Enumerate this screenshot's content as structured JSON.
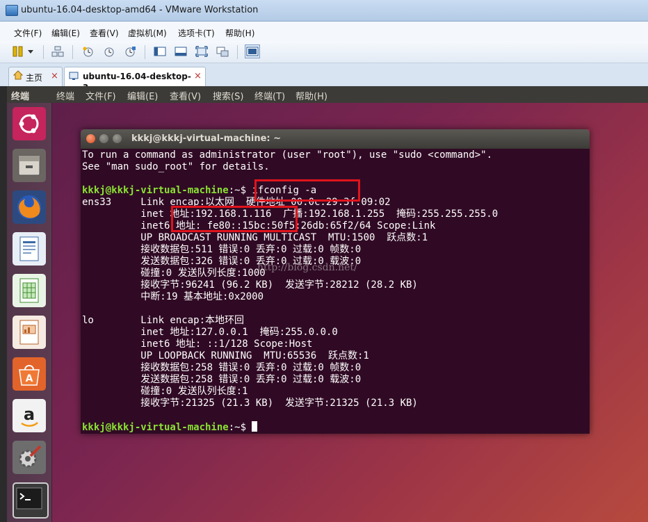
{
  "window": {
    "title": "ubuntu-16.04-desktop-amd64 - VMware Workstation"
  },
  "menu": [
    "文件(F)",
    "编辑(E)",
    "查看(V)",
    "虚拟机(M)",
    "选项卡(T)",
    "帮助(H)"
  ],
  "tabs": [
    {
      "label": "主页",
      "close": "×"
    },
    {
      "label": "ubuntu-16.04-desktop-a...",
      "close": "×"
    }
  ],
  "ubuntu_panel": {
    "app_name": "终端",
    "menu": [
      "终端",
      "文件(F)",
      "编辑(E)",
      "查看(V)",
      "搜索(S)",
      "终端(T)",
      "帮助(H)"
    ]
  },
  "launcher": [
    "ubuntu-dash-icon",
    "files-icon",
    "firefox-icon",
    "writer-icon",
    "calc-icon",
    "impress-icon",
    "software-center-icon",
    "amazon-icon",
    "settings-icon",
    "terminal-icon"
  ],
  "terminal": {
    "title": "kkkj@kkkj-virtual-machine: ~",
    "lines": [
      "To run a command as administrator (user \"root\"), use \"sudo <command>\".",
      "See \"man sudo_root\" for details.",
      "",
      "",
      "ens33     Link encap:以太网  硬件地址 00:0c:29:3f:09:02",
      "          inet 地址:192.168.1.116  广播:192.168.1.255  掩码:255.255.255.0",
      "          inet6 地址: fe80::15bc:50f5:26db:65f2/64 Scope:Link",
      "          UP BROADCAST RUNNING MULTICAST  MTU:1500  跃点数:1",
      "          接收数据包:511 错误:0 丢弃:0 过载:0 帧数:0",
      "          发送数据包:326 错误:0 丢弃:0 过载:0 载波:0",
      "          碰撞:0 发送队列长度:1000",
      "          接收字节:96241 (96.2 KB)  发送字节:28212 (28.2 KB)",
      "          中断:19 基本地址:0x2000",
      "",
      "lo        Link encap:本地环回",
      "          inet 地址:127.0.0.1  掩码:255.0.0.0",
      "          inet6 地址: ::1/128 Scope:Host",
      "          UP LOOPBACK RUNNING  MTU:65536  跃点数:1",
      "          接收数据包:258 错误:0 丢弃:0 过载:0 帧数:0",
      "          发送数据包:258 错误:0 丢弃:0 过载:0 载波:0",
      "          碰撞:0 发送队列长度:1",
      "          接收字节:21325 (21.3 KB)  发送字节:21325 (21.3 KB)",
      "",
      ""
    ],
    "prompt": "kkkj@kkkj-virtual-machine",
    "prompt_path": ":~$ ",
    "command": "ifconfig -a"
  },
  "watermark": "http://blog.csdn.net/",
  "colors": {
    "prompt": "#8ae234",
    "terminal_bg": "#300a24",
    "highlight_box": "#e0141c"
  }
}
